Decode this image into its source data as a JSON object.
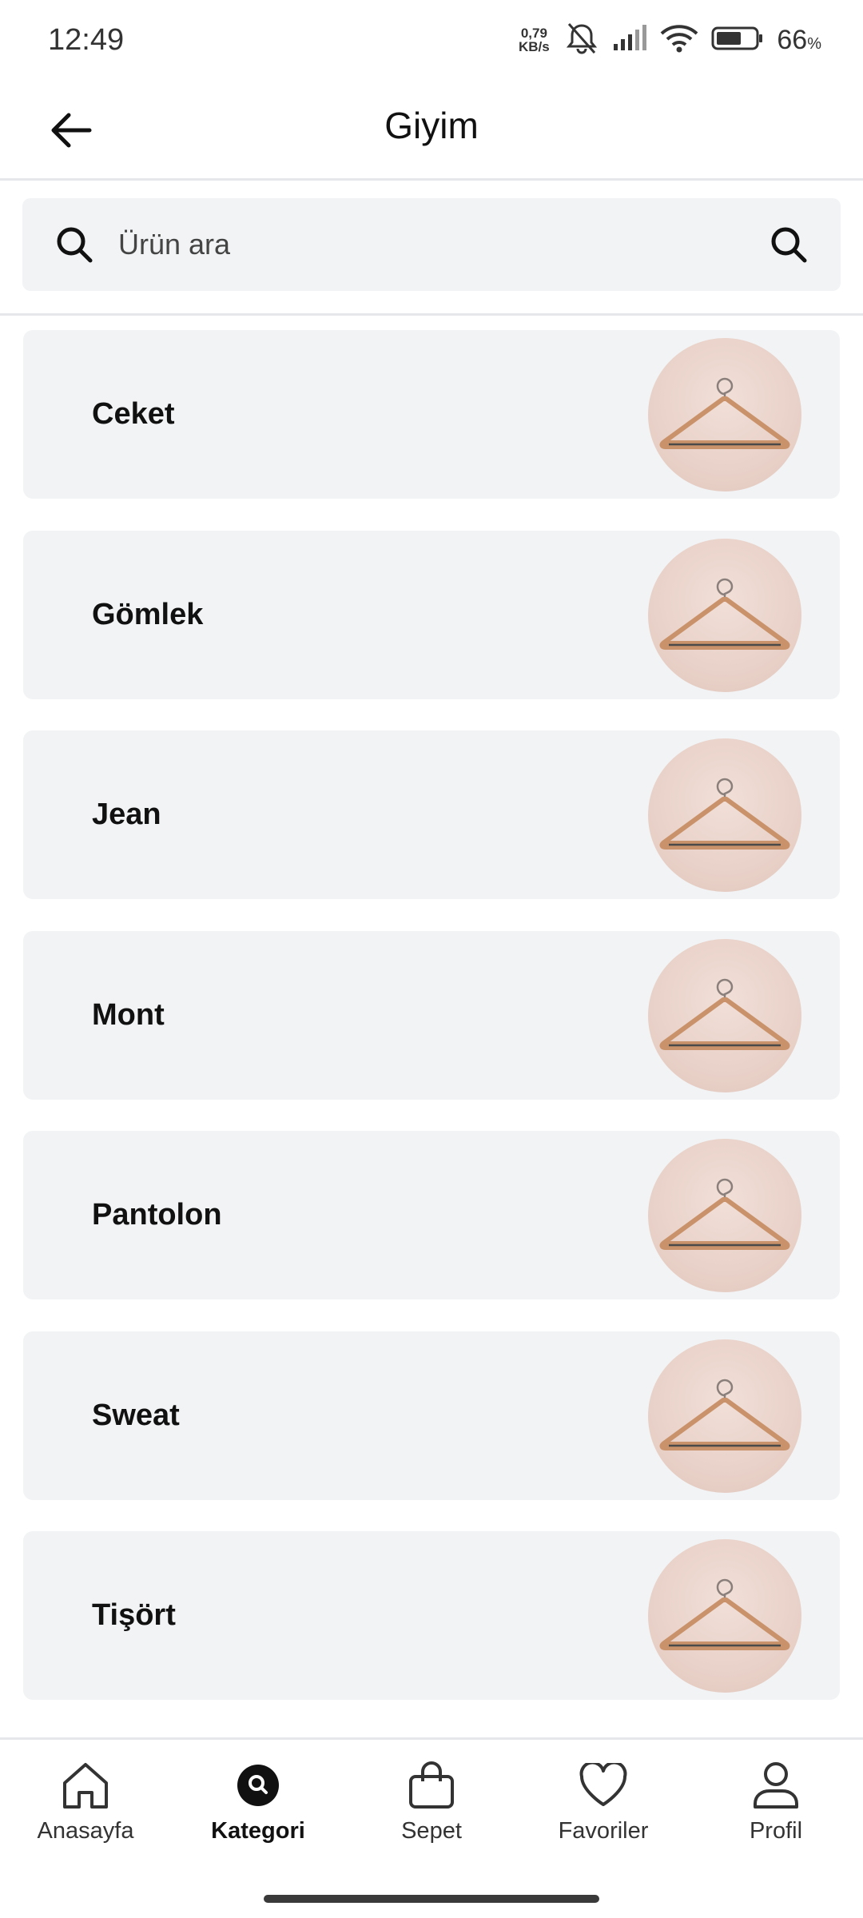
{
  "status": {
    "time": "12:49",
    "net_speed_value": "0,79",
    "net_speed_unit": "KB/s",
    "battery_percent": "66",
    "battery_suffix": "%"
  },
  "header": {
    "title": "Giyim",
    "back_icon": "arrow-left-icon"
  },
  "search": {
    "placeholder": "Ürün ara",
    "value": ""
  },
  "categories": [
    {
      "label": "Ceket",
      "image": "hanger-image"
    },
    {
      "label": "Gömlek",
      "image": "hanger-image"
    },
    {
      "label": "Jean",
      "image": "hanger-image"
    },
    {
      "label": "Mont",
      "image": "hanger-image"
    },
    {
      "label": "Pantolon",
      "image": "hanger-image"
    },
    {
      "label": "Sweat",
      "image": "hanger-image"
    },
    {
      "label": "Tişört",
      "image": "hanger-image"
    }
  ],
  "bottom_nav": {
    "items": [
      {
        "label": "Anasayfa",
        "icon": "home-icon",
        "active": false
      },
      {
        "label": "Kategori",
        "icon": "category-search-icon",
        "active": true
      },
      {
        "label": "Sepet",
        "icon": "bag-icon",
        "active": false
      },
      {
        "label": "Favoriler",
        "icon": "heart-icon",
        "active": false
      },
      {
        "label": "Profil",
        "icon": "user-icon",
        "active": false
      }
    ]
  },
  "colors": {
    "card_background": "#f2f3f5",
    "divider": "#e6e7ea",
    "thumb_background": "#e7cfc6",
    "hanger_wood": "#c9926a"
  }
}
